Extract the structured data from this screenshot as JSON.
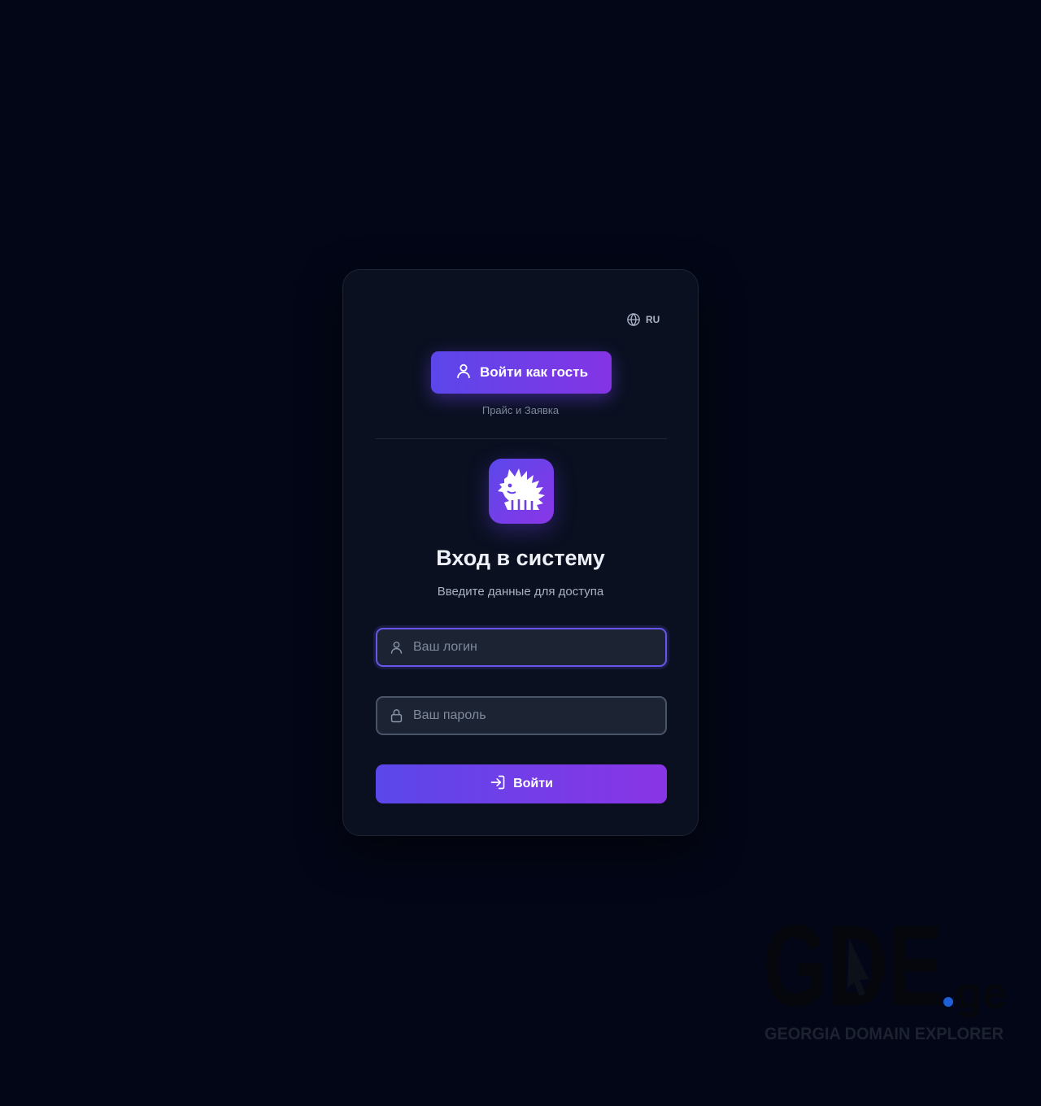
{
  "language": {
    "label": "RU",
    "icon": "globe-icon"
  },
  "guest": {
    "button_label": "Войти как гость",
    "caption": "Прайс и Заявка",
    "icon": "user-icon"
  },
  "brand": {
    "logo_icon": "hedgehog-logo-icon"
  },
  "login_form": {
    "title": "Вход в систему",
    "subtitle": "Введите данные для доступа",
    "username_placeholder": "Ваш логин",
    "username_value": "",
    "password_placeholder": "Ваш пароль",
    "password_value": "",
    "submit_label": "Войти",
    "submit_icon": "sign-in-icon"
  },
  "watermark": {
    "logo_text": "GDE.ge",
    "tagline": "GEORGIA DOMAIN EXPLORER"
  },
  "colors": {
    "background": "#030616",
    "card": "#0a1020",
    "accent_start": "#5b47ea",
    "accent_end": "#8a35e5",
    "input_bg": "#1c2434",
    "focus_border": "#6a55ea"
  }
}
